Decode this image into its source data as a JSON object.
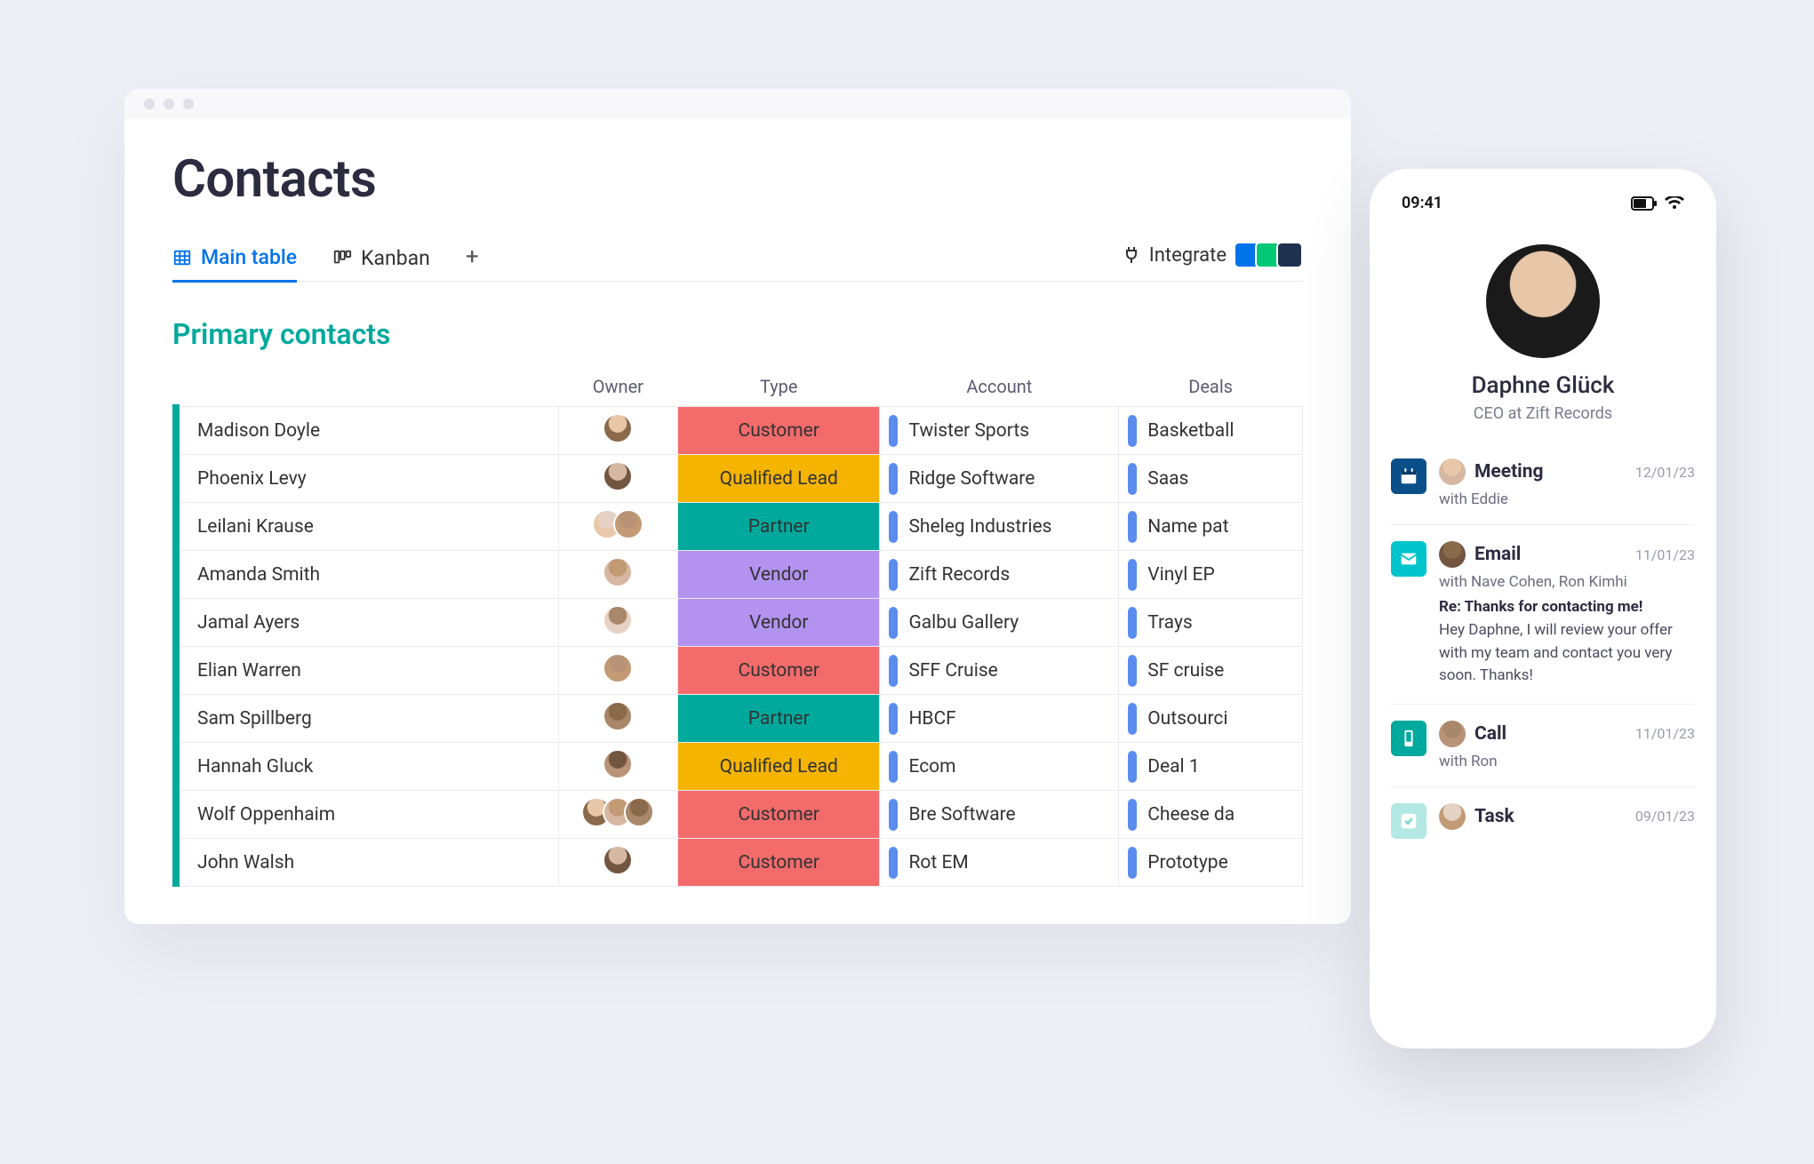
{
  "page": {
    "title": "Contacts"
  },
  "views": {
    "main_table": "Main table",
    "kanban": "Kanban"
  },
  "actions": {
    "integrate": "Integrate"
  },
  "group": {
    "title": "Primary contacts"
  },
  "columns": {
    "name": "",
    "owner": "Owner",
    "type": "Type",
    "account": "Account",
    "deals": "Deals"
  },
  "type_labels": {
    "customer": "Customer",
    "qualified": "Qualified Lead",
    "partner": "Partner",
    "vendor": "Vendor"
  },
  "rows": [
    {
      "name": "Madison Doyle",
      "owners": 1,
      "type": "customer",
      "account": "Twister Sports",
      "deal": "Basketball"
    },
    {
      "name": "Phoenix Levy",
      "owners": 1,
      "type": "qualified",
      "account": "Ridge Software",
      "deal": "Saas"
    },
    {
      "name": "Leilani Krause",
      "owners": 2,
      "type": "partner",
      "account": "Sheleg Industries",
      "deal": "Name pat"
    },
    {
      "name": "Amanda Smith",
      "owners": 1,
      "type": "vendor",
      "account": "Zift Records",
      "deal": "Vinyl EP"
    },
    {
      "name": "Jamal Ayers",
      "owners": 1,
      "type": "vendor",
      "account": "Galbu Gallery",
      "deal": "Trays"
    },
    {
      "name": "Elian Warren",
      "owners": 1,
      "type": "customer",
      "account": "SFF Cruise",
      "deal": "SF cruise"
    },
    {
      "name": "Sam Spillberg",
      "owners": 1,
      "type": "partner",
      "account": "HBCF",
      "deal": "Outsourci"
    },
    {
      "name": "Hannah Gluck",
      "owners": 1,
      "type": "qualified",
      "account": "Ecom",
      "deal": "Deal 1"
    },
    {
      "name": "Wolf Oppenhaim",
      "owners": 3,
      "type": "customer",
      "account": "Bre Software",
      "deal": "Cheese da"
    },
    {
      "name": "John Walsh",
      "owners": 1,
      "type": "customer",
      "account": "Rot EM",
      "deal": "Prototype"
    }
  ],
  "avatar_palette": [
    "#e8c7a8",
    "#c29a74",
    "#8a6a4a",
    "#d6b8a2",
    "#a8876a",
    "#725640",
    "#e6d2c4",
    "#b99377"
  ],
  "mobile": {
    "time": "09:41",
    "profile": {
      "name": "Daphne Glück",
      "subtitle": "CEO at Zift Records"
    },
    "activities": [
      {
        "kind": "meeting",
        "title": "Meeting",
        "date": "12/01/23",
        "with": "with Eddie"
      },
      {
        "kind": "email",
        "title": "Email",
        "date": "11/01/23",
        "with": "with Nave Cohen, Ron Kimhi",
        "subject": "Re: Thanks for contacting me!",
        "snippet": "Hey Daphne, I will review your offer with my team and contact you very soon. Thanks!"
      },
      {
        "kind": "call",
        "title": "Call",
        "date": "11/01/23",
        "with": "with Ron"
      },
      {
        "kind": "task",
        "title": "Task",
        "date": "09/01/23"
      }
    ]
  }
}
